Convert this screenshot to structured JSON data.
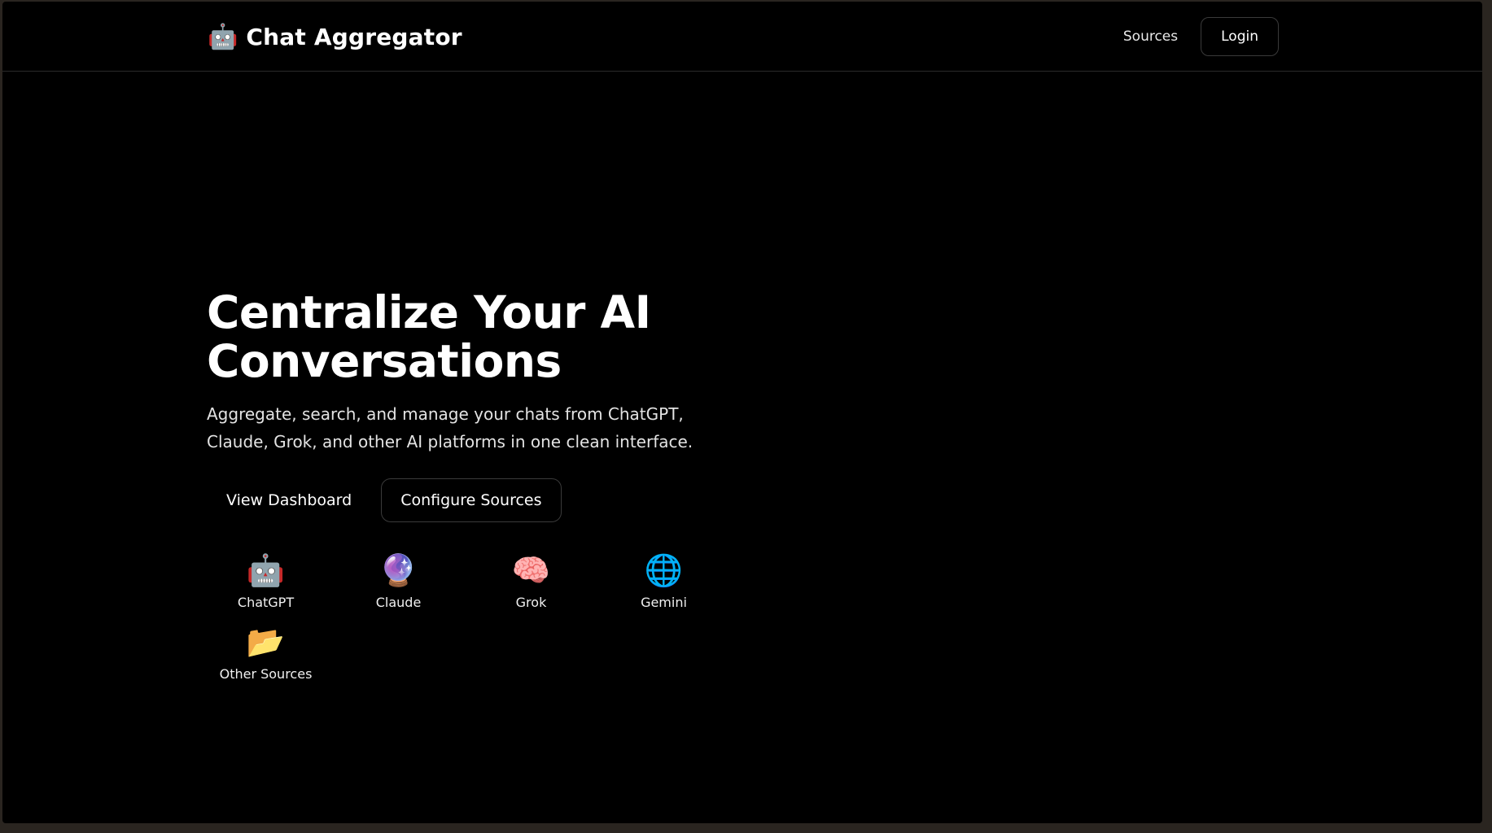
{
  "navbar": {
    "brand_icon": "🤖",
    "brand_icon_name": "robot-icon",
    "brand_title": "Chat Aggregator",
    "sources_link": "Sources",
    "login_button": "Login"
  },
  "hero": {
    "title_line1": "Centralize Your AI",
    "title_line2": "Conversations",
    "subtitle": "Aggregate, search, and manage your chats from ChatGPT, Claude, Grok, and other AI platforms in one clean interface.",
    "view_dashboard": "View Dashboard",
    "configure_sources": "Configure Sources"
  },
  "sources": [
    {
      "icon": "🤖",
      "icon_name": "robot-icon",
      "label": "ChatGPT"
    },
    {
      "icon": "🔮",
      "icon_name": "crystal-ball-icon",
      "label": "Claude"
    },
    {
      "icon": "🧠",
      "icon_name": "brain-icon",
      "label": "Grok"
    },
    {
      "icon": "🌐",
      "icon_name": "globe-icon",
      "label": "Gemini"
    },
    {
      "icon": "📂",
      "icon_name": "open-folder-icon",
      "label": "Other Sources"
    }
  ],
  "colors": {
    "background": "#000000",
    "text": "#ffffff",
    "border": "#3a3a3a"
  }
}
